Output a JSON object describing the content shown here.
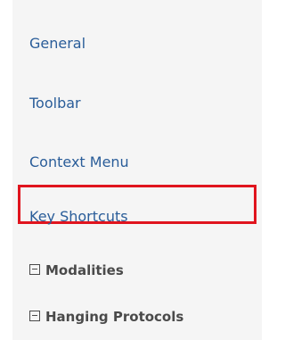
{
  "nav": {
    "items": [
      {
        "label": "General"
      },
      {
        "label": "Toolbar"
      },
      {
        "label": "Context Menu"
      },
      {
        "label": "Key Shortcuts"
      }
    ],
    "groups": [
      {
        "label": "Modalities",
        "icon": "collapse-box-icon"
      },
      {
        "label": "Hanging Protocols",
        "icon": "collapse-box-icon"
      }
    ]
  },
  "highlight_color": "#e0141e",
  "link_color": "#2a5d99"
}
